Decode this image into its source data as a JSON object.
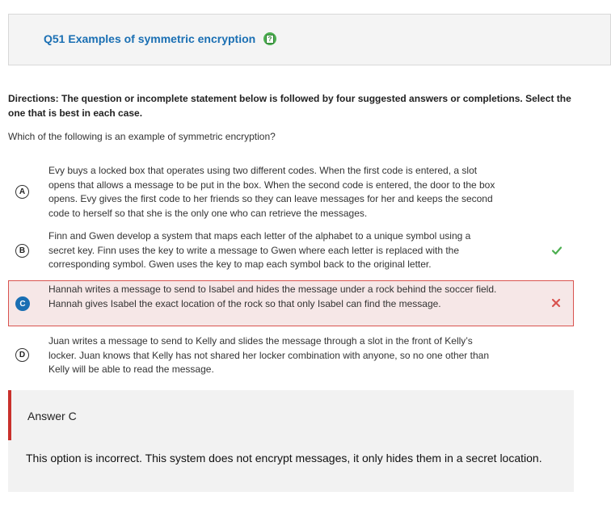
{
  "header": {
    "title": "Q51 Examples of symmetric encryption",
    "help_icon": "help-icon"
  },
  "directions": "Directions: The question or incomplete statement below is followed by four suggested answers or completions. Select the one that is best in each case.",
  "question": "Which of the following is an example of symmetric encryption?",
  "options": [
    {
      "letter": "A",
      "text": "Evy buys a locked box that operates using two different codes. When the first code is entered, a slot opens that allows a message to be put in the box. When the second code is entered, the door to the box opens. Evy gives the first code to her friends so they can leave messages for her and keeps the second code to herself so that she is the only one who can retrieve the messages.",
      "status": "none"
    },
    {
      "letter": "B",
      "text": "Finn and Gwen develop a system that maps each letter of the alphabet to a unique symbol using a secret key. Finn uses the key to write a message to Gwen where each letter is replaced with the corresponding symbol. Gwen uses the key to map each symbol back to the original letter.",
      "status": "correct"
    },
    {
      "letter": "C",
      "text": "Hannah writes a message to send to Isabel and hides the message under a rock behind the soccer field. Hannah gives Isabel the exact location of the rock so that only Isabel can find the message.",
      "status": "selected-incorrect"
    },
    {
      "letter": "D",
      "text": "Juan writes a message to send to Kelly and slides the message through a slot in the front of Kelly’s locker. Juan knows that Kelly has not shared her locker combination with anyone, so no one other than Kelly will be able to read the message.",
      "status": "none"
    }
  ],
  "answer_panel": {
    "label": "Answer C",
    "explanation": "This option is incorrect. This system does not encrypt messages, it only hides them in a secret location."
  },
  "colors": {
    "title_blue": "#1a6fb3",
    "correct_green": "#4caf50",
    "incorrect_red": "#d9534f",
    "selected_bg": "#f6e7e7"
  }
}
